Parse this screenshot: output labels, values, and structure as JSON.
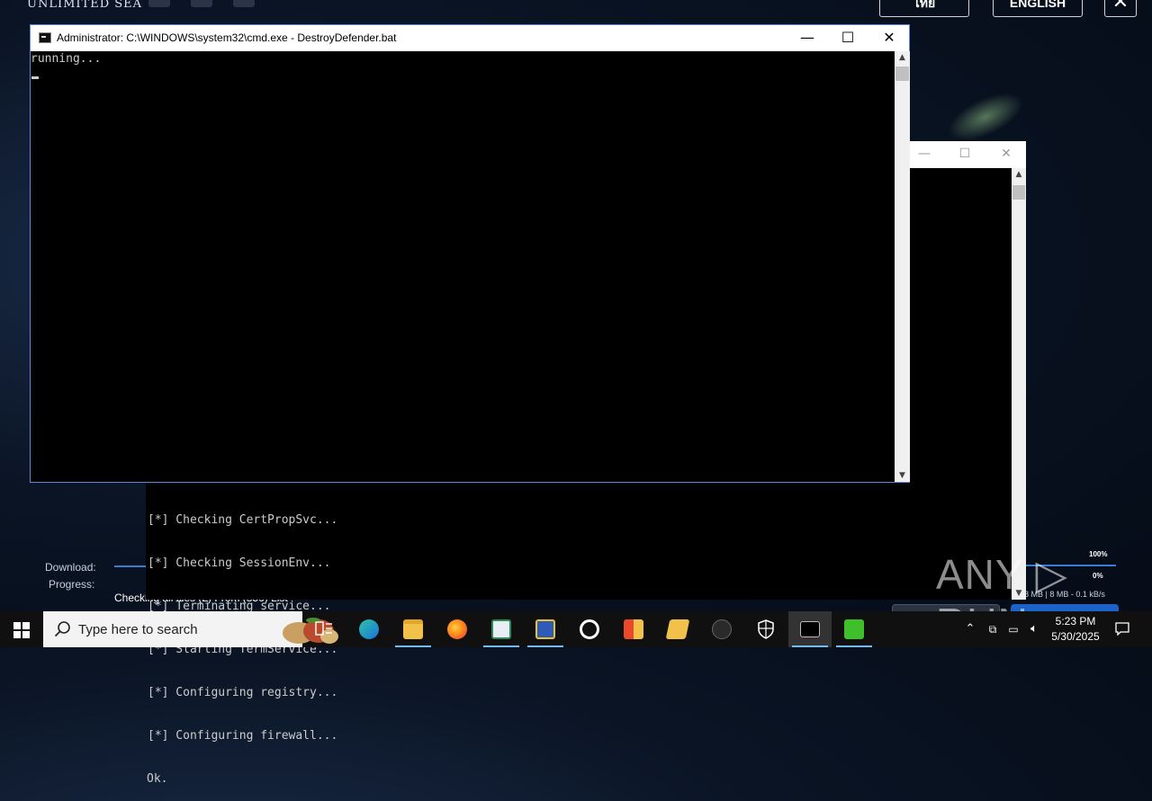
{
  "launcher": {
    "brand": "UNLIMITED SEA",
    "lang_thai": "ไทย",
    "lang_english": "ENGLISH",
    "close": "✕",
    "download_label": "Download:",
    "progress_label": "Progress:",
    "checking_text": "Checking all files (2) From (856) List",
    "pct_top": "100%",
    "pct_bottom": "0%",
    "speed_text": "8 MB | 8 MB - 0.1 kB/s",
    "update_label": "UPDATE",
    "start_label": "START GAME"
  },
  "bg_console": {
    "lines": [
      "[*] Checking CertPropSvc...",
      "[*] Checking SessionEnv...",
      "[*] Terminating service...",
      "[*] Starting TermService...",
      "[*] Configuring registry...",
      "[*] Configuring firewall...",
      "Ok."
    ]
  },
  "cmd_window": {
    "title": "Administrator: C:\\WINDOWS\\system32\\cmd.exe - DestroyDefender.bat",
    "output": "running...",
    "minimize": "—",
    "maximize": "☐",
    "close": "✕"
  },
  "watermark": "ANY ▷ RUN",
  "taskbar": {
    "search_placeholder": "Type here to search",
    "apps": [
      "task-view",
      "edge",
      "file-explorer",
      "firefox",
      "app-window",
      "network-tool",
      "ccleaner",
      "office-app",
      "folder-note",
      "terminal-app",
      "defender",
      "cmd",
      "green-app"
    ],
    "time": "5:23 PM",
    "date": "5/30/2025"
  }
}
